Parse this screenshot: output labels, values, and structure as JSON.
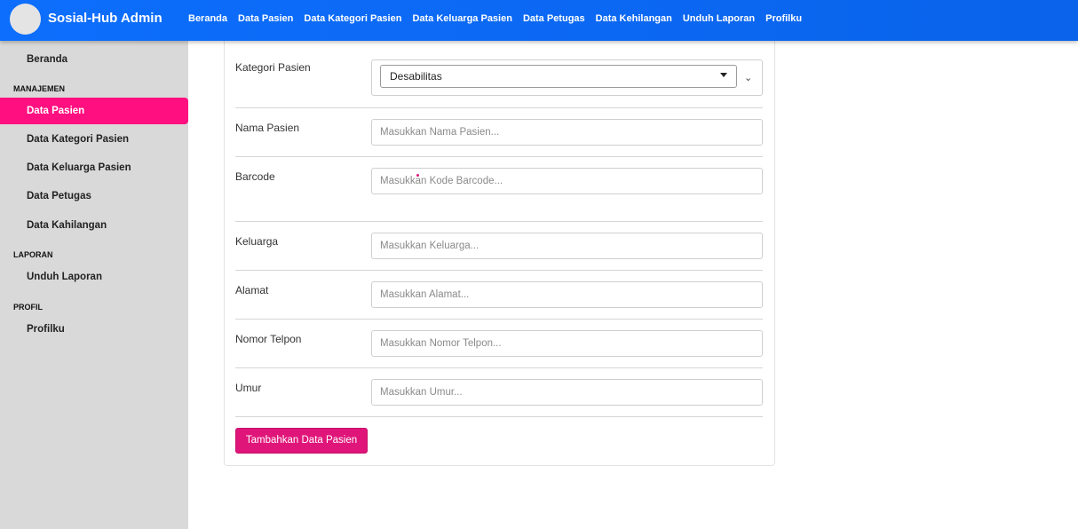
{
  "header": {
    "brand": "Sosial-Hub Admin",
    "nav": [
      "Beranda",
      "Data Pasien",
      "Data Kategori Pasien",
      "Data Keluarga Pasien",
      "Data Petugas",
      "Data Kehilangan",
      "Unduh Laporan",
      "Profilku"
    ]
  },
  "sidebar": {
    "beranda": "Beranda",
    "section_manajemen": "MANAJEMEN",
    "data_pasien": "Data Pasien",
    "data_kategori": "Data Kategori Pasien",
    "data_keluarga": "Data Keluarga Pasien",
    "data_petugas": "Data Petugas",
    "data_kehilangan": "Data Kahilangan",
    "section_laporan": "LAPORAN",
    "unduh_laporan": "Unduh Laporan",
    "section_profil": "PROFIL",
    "profilku": "Profilku"
  },
  "form": {
    "kategori_label": "Kategori Pasien",
    "kategori_value": "Desabilitas",
    "nama_label": "Nama Pasien",
    "nama_placeholder": "Masukkan Nama Pasien...",
    "barcode_label": "Barcode",
    "barcode_placeholder": "Masukkan Kode Barcode...",
    "keluarga_label": "Keluarga",
    "keluarga_placeholder": "Masukkan Keluarga...",
    "alamat_label": "Alamat",
    "alamat_placeholder": "Masukkan Alamat...",
    "telpon_label": "Nomor Telpon",
    "telpon_placeholder": "Masukkan Nomor Telpon...",
    "umur_label": "Umur",
    "umur_placeholder": "Masukkan Umur...",
    "submit_label": "Tambahkan Data Pasien"
  },
  "colors": {
    "topbar": "#0d6efd",
    "accent": "#ff0f80",
    "sidebar": "#d9d9d9"
  }
}
